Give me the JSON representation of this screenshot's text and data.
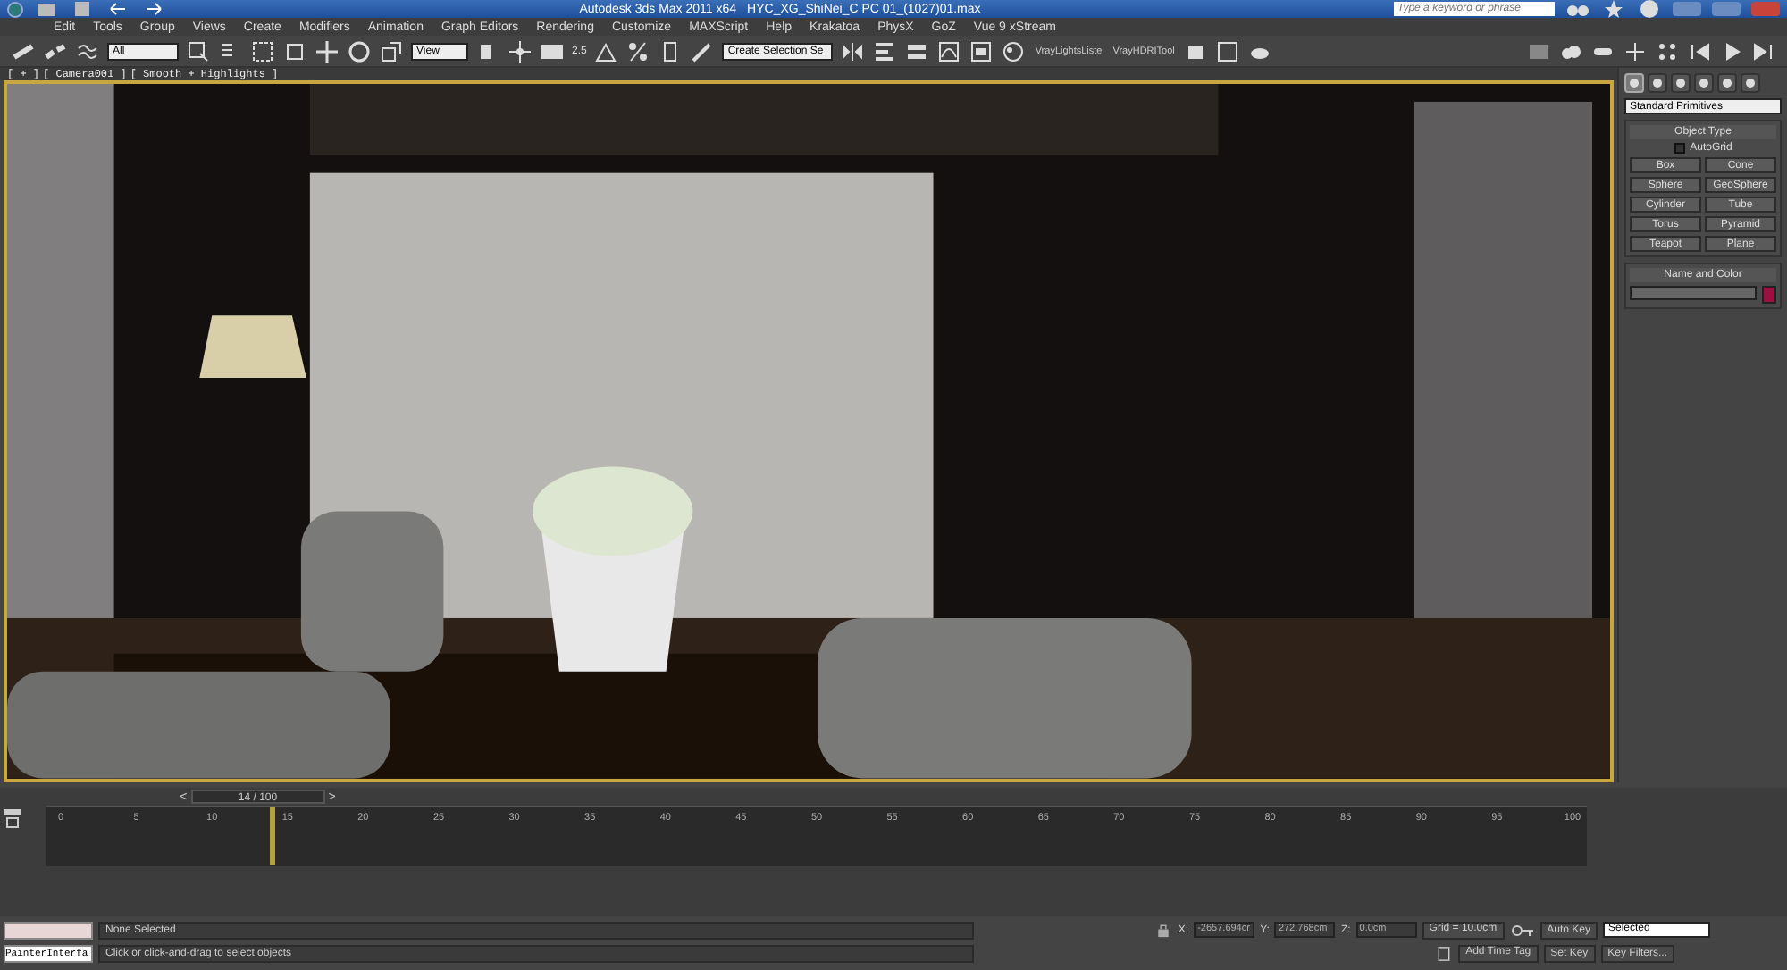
{
  "window": {
    "app_title": "Autodesk 3ds Max  2011 x64",
    "file_title": "HYC_XG_ShiNei_C PC 01_(1027)01.max",
    "search": {
      "placeholder": "Type a keyword or phrase"
    }
  },
  "menus": [
    "Edit",
    "Tools",
    "Group",
    "Views",
    "Create",
    "Modifiers",
    "Animation",
    "Graph Editors",
    "Rendering",
    "Customize",
    "MAXScript",
    "Help",
    "Krakatoa",
    "PhysX",
    "GoZ",
    "Vue 9 xStream"
  ],
  "toolbar": {
    "selection_filter": "All",
    "reference_coordinate": "View",
    "angle_snap": "2.5",
    "named_selection": "Create Selection Se",
    "plugin_buttons": [
      "VrayLightsListe",
      "VrayHDRITool"
    ]
  },
  "viewport": {
    "labels": [
      "[ + ]",
      "[ Camera001 ]",
      "[ Smooth + Highlights ]"
    ]
  },
  "command_panel": {
    "tabs": [
      {
        "selected": true
      },
      {
        "selected": false
      },
      {
        "selected": false
      },
      {
        "selected": false
      },
      {
        "selected": false
      },
      {
        "selected": false
      }
    ],
    "category": "Standard Primitives",
    "rollouts": [
      {
        "title": "Object Type",
        "autogrid": {
          "label": "AutoGrid",
          "checked": false
        },
        "buttons": [
          "Box",
          "Cone",
          "Sphere",
          "GeoSphere",
          "Cylinder",
          "Tube",
          "Torus",
          "Pyramid",
          "Teapot",
          "Plane"
        ]
      },
      {
        "title": "Name and Color",
        "color": "#9a1040"
      }
    ]
  },
  "timeline": {
    "previous": "<",
    "frame": "14 / 100",
    "next": ">",
    "level": 0.14,
    "ticks": [
      "0",
      "5",
      "10",
      "15",
      "20",
      "25",
      "30",
      "35",
      "40",
      "45",
      "50",
      "55",
      "60",
      "65",
      "70",
      "75",
      "80",
      "85",
      "90",
      "95",
      "100"
    ]
  },
  "status_bar": {
    "listener": "PainterInterfa",
    "selection": "None Selected",
    "prompt": "Click or click-and-drag to select objects",
    "x_label": "X:",
    "x": "-2657.694cr",
    "y_label": "Y:",
    "y": "272.768cm",
    "z_label": "Z:",
    "z": "0.0cm",
    "grid": "Grid = 10.0cm",
    "add_time_tag": "Add Time Tag",
    "auto_key": "Auto Key",
    "key_mode": "Selected",
    "set_key": "Set Key",
    "key_filters": "Key Filters..."
  }
}
